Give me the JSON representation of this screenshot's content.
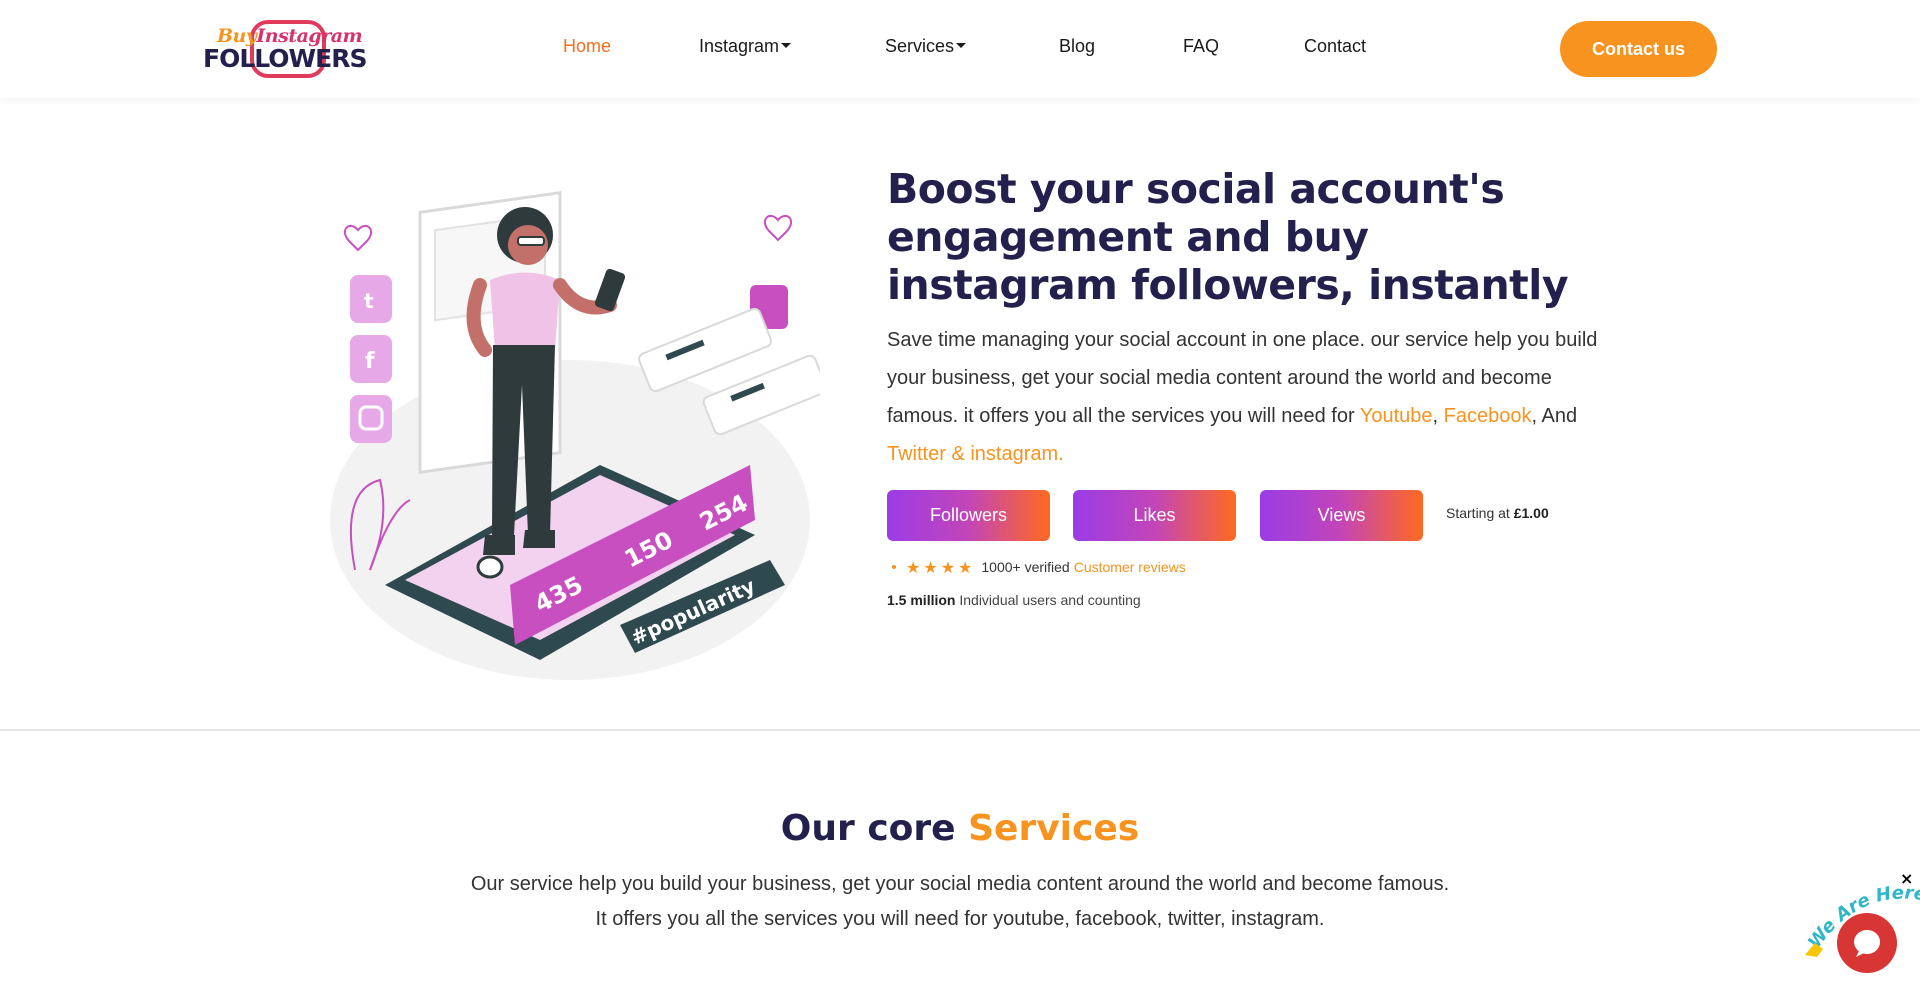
{
  "header": {
    "logo": {
      "top_left": "Buy",
      "top_right": "Instagram",
      "bottom": "FOLLOWERS"
    },
    "nav": [
      {
        "label": "Home",
        "active": true,
        "dropdown": false
      },
      {
        "label": "Instagram",
        "active": false,
        "dropdown": true
      },
      {
        "label": "Services",
        "active": false,
        "dropdown": true
      },
      {
        "label": "Blog",
        "active": false,
        "dropdown": false
      },
      {
        "label": "FAQ",
        "active": false,
        "dropdown": false
      },
      {
        "label": "Contact",
        "active": false,
        "dropdown": false
      }
    ],
    "contact_button": "Contact us"
  },
  "hero": {
    "title": "Boost your social account's engagement and buy instagram followers, instantly",
    "description_1": "Save time managing your social account in one place. our service help you build your business, get your social media content around the world and become famous. it offers you all the services you will need for ",
    "link_youtube": "Youtube",
    "sep_1": ", ",
    "link_facebook": "Facebook",
    "sep_2": ", And ",
    "link_twitter": "Twitter & instagram.",
    "buttons": {
      "followers": "Followers",
      "likes": "Likes",
      "views": "Views"
    },
    "starting_label": "Starting at ",
    "starting_price": "£1.00",
    "reviews_text": "1000+ verified",
    "reviews_link": "Customer reviews",
    "users_count": "1.5 million",
    "users_text": " Individual users and counting",
    "illustration": {
      "likes": "435",
      "comments": "150",
      "followers": "254",
      "hashtag": "#popularity"
    }
  },
  "services": {
    "title_plain": "Our core ",
    "title_accent": "Services",
    "line_1": "Our service help you build your business, get your social media content around the world and become famous.",
    "line_2": "It offers you all the services you will need for youtube, facebook, twitter, instagram."
  },
  "chat": {
    "tag": "We Are Here!",
    "close": "×"
  },
  "colors": {
    "accent": "#f7931e",
    "navy": "#23204d",
    "purple": "#9b3ce6",
    "chat_red": "#d83535"
  }
}
